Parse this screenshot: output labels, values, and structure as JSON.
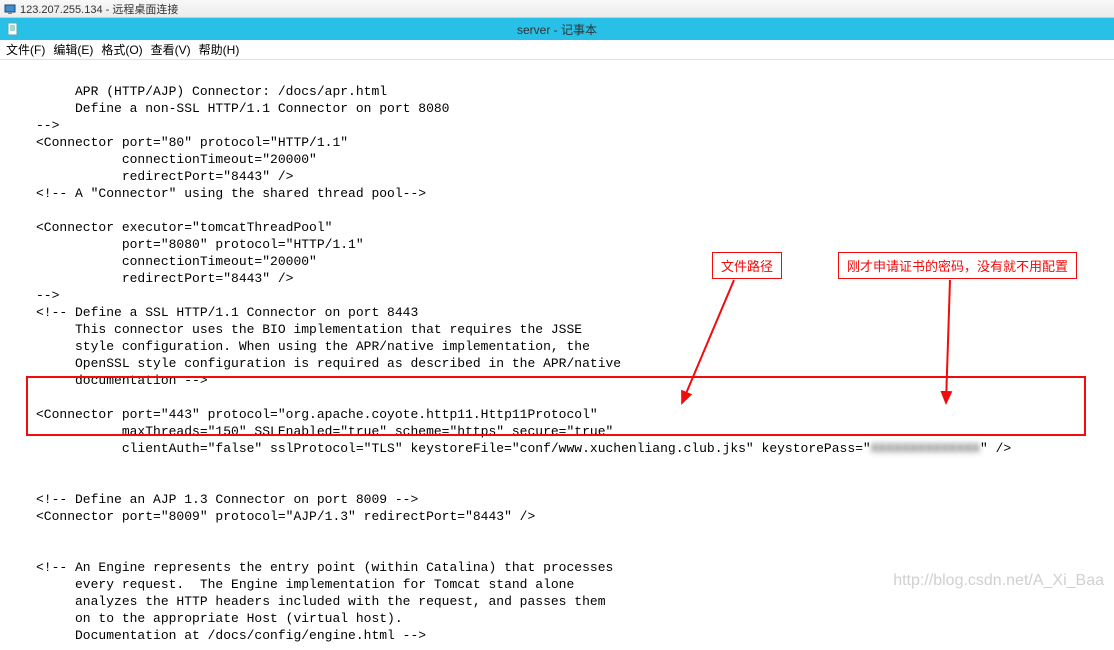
{
  "outer_title": "123.207.255.134 - 远程桌面连接",
  "inner_title": "server - 记事本",
  "menu": {
    "file": "文件(F)",
    "edit": "编辑(E)",
    "format": "格式(O)",
    "view": "查看(V)",
    "help": "帮助(H)"
  },
  "code": {
    "l1": "     APR (HTTP/AJP) Connector: /docs/apr.html",
    "l2": "     Define a non-SSL HTTP/1.1 Connector on port 8080",
    "l3": "-->",
    "l4": "<Connector port=\"80\" protocol=\"HTTP/1.1\"",
    "l5": "           connectionTimeout=\"20000\"",
    "l6": "           redirectPort=\"8443\" />",
    "l7": "<!-- A \"Connector\" using the shared thread pool-->",
    "l8": "",
    "l9": "<Connector executor=\"tomcatThreadPool\"",
    "l10": "           port=\"8080\" protocol=\"HTTP/1.1\"",
    "l11": "           connectionTimeout=\"20000\"",
    "l12": "           redirectPort=\"8443\" />",
    "l13": "-->",
    "l14": "<!-- Define a SSL HTTP/1.1 Connector on port 8443",
    "l15": "     This connector uses the BIO implementation that requires the JSSE",
    "l16": "     style configuration. When using the APR/native implementation, the",
    "l17": "     OpenSSL style configuration is required as described in the APR/native",
    "l18": "     documentation -->",
    "l19": "",
    "l20": "<Connector port=\"443\" protocol=\"org.apache.coyote.http11.Http11Protocol\"",
    "l21": "           maxThreads=\"150\" SSLEnabled=\"true\" scheme=\"https\" secure=\"true\"",
    "l22a": "           clientAuth=\"false\" sslProtocol=\"TLS\" keystoreFile=\"conf/www.xuchenliang.club.jks\" keystorePass=\"",
    "l22b": "XXXXXXXXXXXXXX",
    "l22c": "\" />",
    "l23": "",
    "l24": "",
    "l25": "<!-- Define an AJP 1.3 Connector on port 8009 -->",
    "l26": "<Connector port=\"8009\" protocol=\"AJP/1.3\" redirectPort=\"8443\" />",
    "l27": "",
    "l28": "",
    "l29": "<!-- An Engine represents the entry point (within Catalina) that processes",
    "l30": "     every request.  The Engine implementation for Tomcat stand alone",
    "l31": "     analyzes the HTTP headers included with the request, and passes them",
    "l32": "     on to the appropriate Host (virtual host).",
    "l33": "     Documentation at /docs/config/engine.html -->"
  },
  "annotations": {
    "file_path": "文件路径",
    "cert_password": "刚才申请证书的密码，没有就不用配置"
  },
  "watermark": "http://blog.csdn.net/A_Xi_Baa"
}
